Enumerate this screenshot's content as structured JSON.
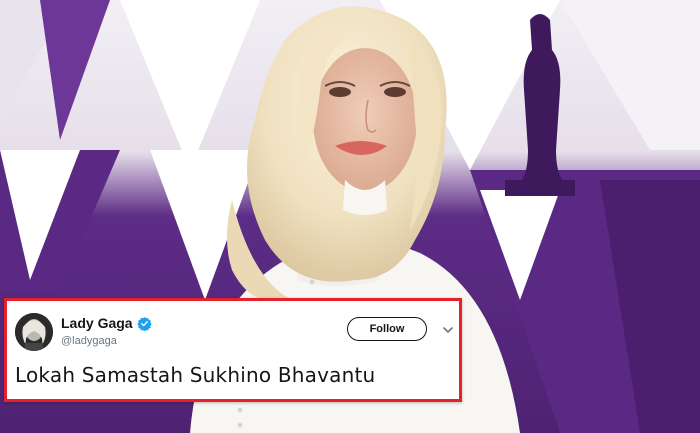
{
  "tweet": {
    "display_name": "Lady Gaga",
    "handle": "@ladygaga",
    "follow_label": "Follow",
    "text": "Lokah Samastah Sukhino Bhavantu",
    "verified_icon": "verified-badge-icon",
    "menu_icon": "chevron-down-icon"
  },
  "colors": {
    "highlight_border": "#e8202a",
    "verified_blue": "#1da1f2",
    "backdrop_purple": "#5b2a82",
    "text_dark": "#14171a",
    "text_muted": "#657786"
  }
}
